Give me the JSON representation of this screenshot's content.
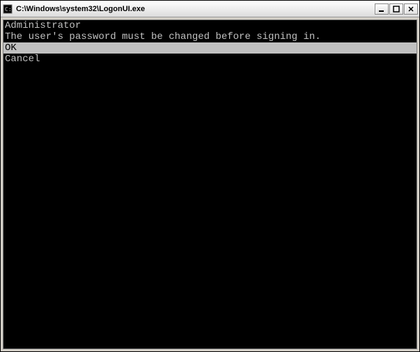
{
  "titlebar": {
    "title": "C:\\Windows\\system32\\LogonUI.exe"
  },
  "console": {
    "user_line": "Administrator",
    "message_line": "The user's password must be changed before signing in.",
    "option_ok": "OK",
    "option_cancel": "Cancel"
  }
}
